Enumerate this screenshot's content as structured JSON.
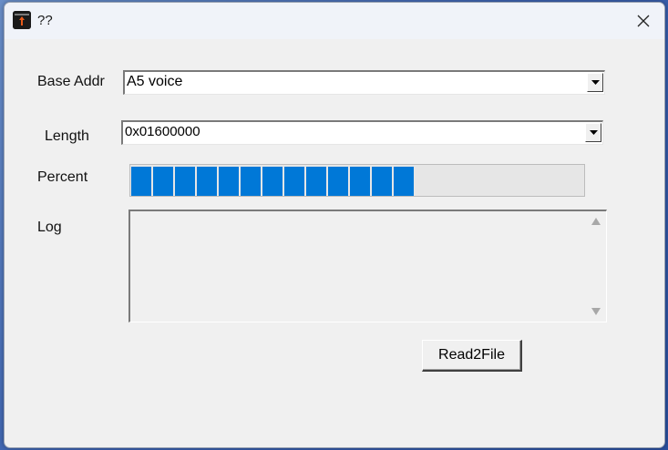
{
  "window": {
    "title": "??",
    "icon": "app-flame-icon",
    "close_icon": "close-icon"
  },
  "form": {
    "base_addr_label": "Base Addr",
    "base_addr_value": "A5 voice",
    "length_label": "Length",
    "length_value": "0x01600000",
    "percent_label": "Percent",
    "progress_blocks": 13,
    "log_label": "Log",
    "log_text": ""
  },
  "actions": {
    "read_button_label": "Read2File"
  },
  "colors": {
    "progress_fill": "#0078d7",
    "window_bg": "#f0f0f0"
  }
}
